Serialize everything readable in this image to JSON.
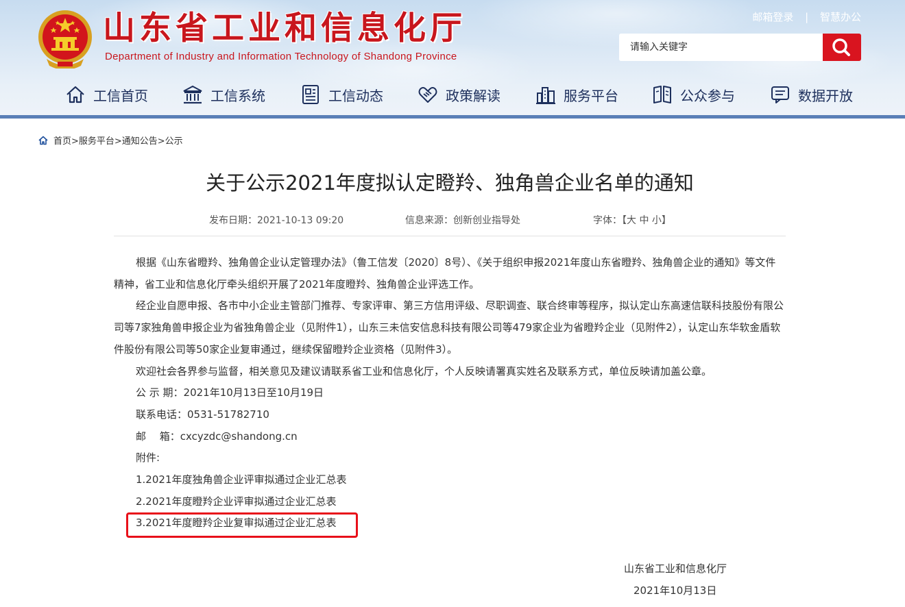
{
  "header": {
    "title_cn": "山东省工业和信息化厅",
    "title_en": "Department of Industry and Information Technology of Shandong Province",
    "top_links": [
      "邮箱登录",
      "智慧办公"
    ],
    "top_separator": "|",
    "search": {
      "placeholder": "请输入关键字",
      "value": ""
    },
    "accent_color": "#d9141f",
    "nav": [
      {
        "label": "工信首页",
        "icon": "home-icon"
      },
      {
        "label": "工信系统",
        "icon": "government-building-icon"
      },
      {
        "label": "工信动态",
        "icon": "news-icon"
      },
      {
        "label": "政策解读",
        "icon": "handshake-icon"
      },
      {
        "label": "服务平台",
        "icon": "city-icon"
      },
      {
        "label": "公众参与",
        "icon": "open-book-icon"
      },
      {
        "label": "数据开放",
        "icon": "message-icon"
      }
    ]
  },
  "breadcrumb": {
    "text": "首页>服务平台>通知公告>公示"
  },
  "article": {
    "title": "关于公示2021年度拟认定瞪羚、独角兽企业名单的通知",
    "publish_date": "发布日期：2021-10-13 09:20",
    "source": "信息来源：创新创业指导处",
    "font_size_label": "字体：【大 中 小】",
    "paragraphs": [
      "根据《山东省瞪羚、独角兽企业认定管理办法》（鲁工信发〔2020〕8号）、《关于组织申报2021年度山东省瞪羚、独角兽企业的通知》等文件精神，省工业和信息化厅牵头组织开展了2021年度瞪羚、独角兽企业评选工作。",
      "经企业自愿申报、各市中小企业主管部门推荐、专家评审、第三方信用评级、尽职调查、联合终审等程序，拟认定山东高速信联科技股份有限公司等7家独角兽申报企业为省独角兽企业（见附件1），山东三未信安信息科技有限公司等479家企业为省瞪羚企业（见附件2），认定山东华软金盾软件股份有限公司等50家企业复审通过，继续保留瞪羚企业资格（见附件3）。",
      "欢迎社会各界参与监督，相关意见及建议请联系省工业和信息化厅，个人反映请署真实姓名及联系方式，单位反映请加盖公章。"
    ],
    "period": "公 示 期：2021年10月13日至10月19日",
    "phone": "联系电话：0531-51782710",
    "email": "邮　 箱：cxcyzdc@shandong.cn",
    "attachments_label": "附件:",
    "attachments": [
      "1.2021年度独角兽企业评审拟通过企业汇总表",
      "2.2021年度瞪羚企业评审拟通过企业汇总表",
      "3.2021年度瞪羚企业复审拟通过企业汇总表"
    ],
    "signature_org": "山东省工业和信息化厅",
    "signature_date": "2021年10月13日"
  }
}
